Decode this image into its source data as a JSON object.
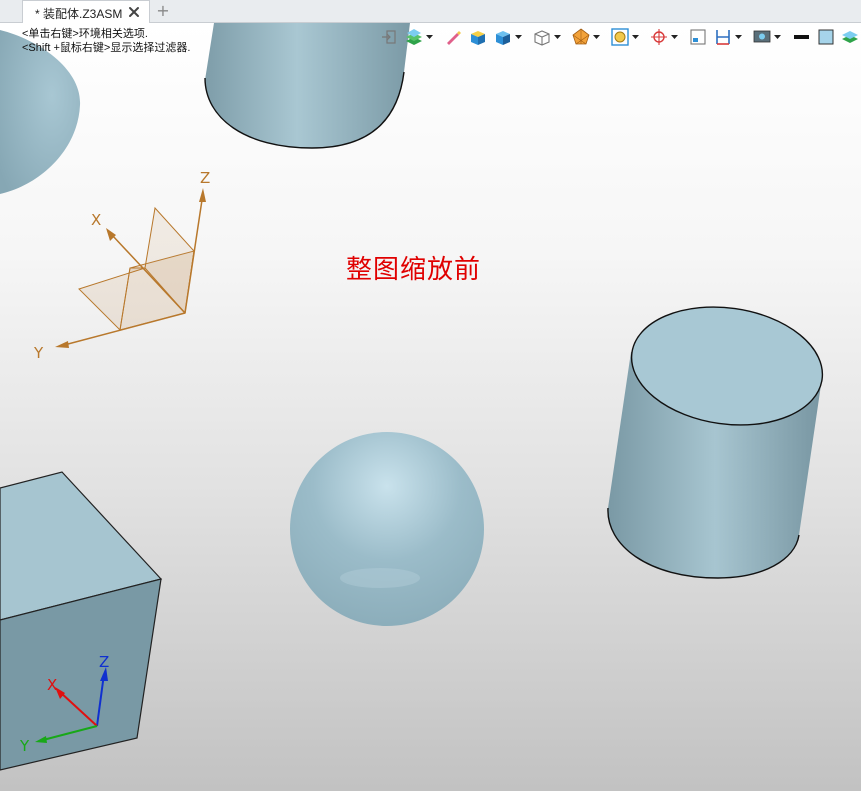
{
  "tab": {
    "title": "* 装配体.Z3ASM"
  },
  "hints": {
    "line1": "<单击右键>环境相关选项.",
    "line2": "<Shift +鼠标右键>显示选择过滤器."
  },
  "annotation": "整图缩放前",
  "triad": {
    "x": "X",
    "y": "Y",
    "z": "Z"
  },
  "axis_indicator": {
    "x": "X",
    "y": "Y",
    "z": "Z"
  },
  "colors": {
    "body": "#97b7c4",
    "triad": "#b8782c",
    "axis_x": "#e01010",
    "axis_y": "#18a818",
    "axis_z": "#1030d0",
    "annotation": "#e00000"
  }
}
